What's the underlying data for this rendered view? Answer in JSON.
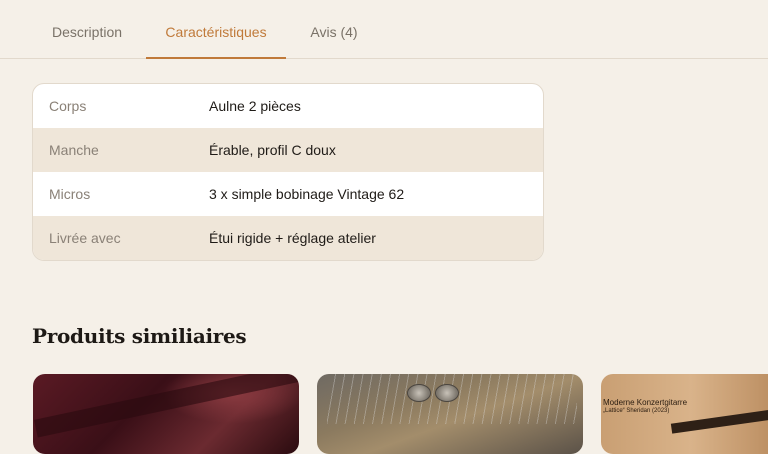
{
  "tabs": [
    {
      "label": "Description"
    },
    {
      "label": "Caractéristiques",
      "active": true
    },
    {
      "label": "Avis (4)"
    }
  ],
  "specs": [
    {
      "key": "Corps",
      "value": "Aulne 2 pièces"
    },
    {
      "key": "Manche",
      "value": "Érable, profil C doux"
    },
    {
      "key": "Micros",
      "value": "3 x simple bobinage Vintage 62"
    },
    {
      "key": "Livrée avec",
      "value": "Étui rigide + réglage atelier"
    }
  ],
  "similar": {
    "title": "Produits similiaires",
    "cards": [
      {
        "image": "guitar-in-red-case"
      },
      {
        "image": "guitar-with-coins"
      },
      {
        "image": "concert-guitar-poster",
        "caption_line1": "Moderne Konzertgitarre",
        "caption_line2": "„Lattice“ Sheridan (2023)"
      }
    ]
  },
  "colors": {
    "accent": "#c07a3a",
    "background": "#f5f0e8",
    "row_alt": "#efe6d9"
  }
}
